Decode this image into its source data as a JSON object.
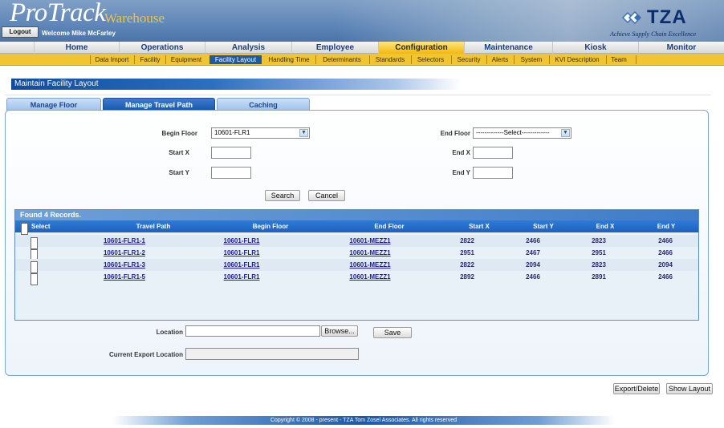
{
  "header": {
    "logo_main": "ProTrack",
    "logo_sub": "Warehouse",
    "logout_label": "Logout",
    "welcome_text": "Welcome Mike McFarley",
    "brand": "TZA",
    "brand_tagline": "Achieve Supply Chain Excellence"
  },
  "main_nav": {
    "items": [
      {
        "label": "Home"
      },
      {
        "label": "Operations"
      },
      {
        "label": "Analysis"
      },
      {
        "label": "Employee"
      },
      {
        "label": "Configuration",
        "active": true
      },
      {
        "label": "Maintenance"
      },
      {
        "label": "Kiosk"
      },
      {
        "label": "Monitor"
      }
    ]
  },
  "sub_nav": {
    "items": [
      {
        "label": "Data Import"
      },
      {
        "label": "Facility"
      },
      {
        "label": "Equipment"
      },
      {
        "label": "Facility Layout",
        "active": true
      },
      {
        "label": "Handling Time"
      },
      {
        "label": "Determinants"
      },
      {
        "label": "Standards"
      },
      {
        "label": "Selectors"
      },
      {
        "label": "Security"
      },
      {
        "label": "Alerts"
      },
      {
        "label": "System"
      },
      {
        "label": "KVI Description"
      },
      {
        "label": "Team"
      }
    ]
  },
  "page": {
    "title": "Maintain Facility Layout",
    "tabs": [
      {
        "label": "Manage Floor"
      },
      {
        "label": "Manage Travel Path",
        "active": true
      },
      {
        "label": "Caching"
      }
    ]
  },
  "form": {
    "begin_floor_label": "Begin Floor",
    "begin_floor_value": "10601-FLR1",
    "end_floor_label": "End Floor",
    "end_floor_value": "-------------Select-------------",
    "start_x_label": "Start X",
    "start_y_label": "Start Y",
    "end_x_label": "End X",
    "end_y_label": "End Y",
    "search_label": "Search",
    "cancel_label": "Cancel"
  },
  "grid": {
    "caption": "Found 4 Records.",
    "columns": [
      "Select",
      "Travel Path",
      "Begin Floor",
      "End Floor",
      "Start X",
      "Start Y",
      "End X",
      "End Y"
    ],
    "rows": [
      {
        "travel_path": "10601-FLR1-1",
        "begin_floor": "10601-FLR1",
        "end_floor": "10601-MEZZ1",
        "start_x": "2822",
        "start_y": "2466",
        "end_x": "2823",
        "end_y": "2466"
      },
      {
        "travel_path": "10601-FLR1-2",
        "begin_floor": "10601-FLR1",
        "end_floor": "10601-MEZZ1",
        "start_x": "2951",
        "start_y": "2467",
        "end_x": "2951",
        "end_y": "2466"
      },
      {
        "travel_path": "10601-FLR1-3",
        "begin_floor": "10601-FLR1",
        "end_floor": "10601-MEZZ1",
        "start_x": "2822",
        "start_y": "2094",
        "end_x": "2823",
        "end_y": "2094"
      },
      {
        "travel_path": "10601-FLR1-5",
        "begin_floor": "10601-FLR1",
        "end_floor": "10601-MEZZ1",
        "start_x": "2892",
        "start_y": "2466",
        "end_x": "2891",
        "end_y": "2466"
      }
    ]
  },
  "export": {
    "location_label": "Location",
    "browse_label": "Browse...",
    "save_label": "Save",
    "current_export_label": "Current Export Location",
    "export_delete_label": "Export/Delete",
    "show_layout_label": "Show Layout"
  },
  "footer": {
    "copyright": "Copyright © 2008 - present - TZA Tom Zosel Associates. All rights reserved"
  },
  "colors": {
    "header_blue": "#5f86b8",
    "nav_gold": "#f1c531",
    "active_tab_blue": "#1757aa",
    "link_blue": "#1a1aa0"
  }
}
